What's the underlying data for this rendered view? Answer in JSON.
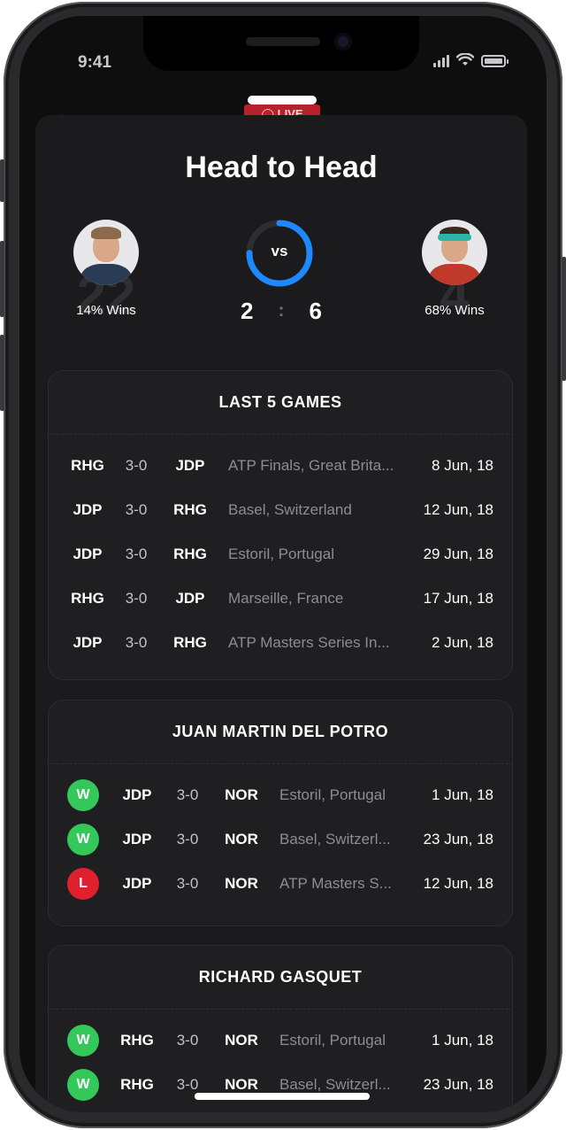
{
  "status": {
    "time": "9:41"
  },
  "background": {
    "back_glyph": "‹",
    "live_label": "◯ LIVE"
  },
  "sheet": {
    "title": "Head to Head"
  },
  "players": {
    "left": {
      "number": "22",
      "wins": "14% Wins",
      "shirt_color": "#2a3c55",
      "hair_color": "#8a6a4a"
    },
    "right": {
      "number": "4",
      "wins": "68% Wins",
      "shirt_color": "#c0392b",
      "hair_color": "#3b2a1f"
    }
  },
  "vs": {
    "label": "vs",
    "left_score": "2",
    "separator": ":",
    "right_score": "6",
    "ring_fraction": 0.75,
    "ring_color": "#1e88ff"
  },
  "last_games": {
    "title": "LAST 5 GAMES",
    "rows": [
      {
        "p1": "RHG",
        "score": "3-0",
        "p2": "JDP",
        "event": "ATP Finals, Great Brita...",
        "date": "8 Jun, 18"
      },
      {
        "p1": "JDP",
        "score": "3-0",
        "p2": "RHG",
        "event": "Basel, Switzerland",
        "date": "12 Jun, 18"
      },
      {
        "p1": "JDP",
        "score": "3-0",
        "p2": "RHG",
        "event": "Estoril, Portugal",
        "date": "29 Jun, 18"
      },
      {
        "p1": "RHG",
        "score": "3-0",
        "p2": "JDP",
        "event": "Marseille, France",
        "date": "17 Jun, 18"
      },
      {
        "p1": "JDP",
        "score": "3-0",
        "p2": "RHG",
        "event": "ATP Masters Series In...",
        "date": "2 Jun, 18"
      }
    ]
  },
  "potro": {
    "title": "JUAN MARTIN DEL POTRO",
    "rows": [
      {
        "result": "W",
        "p1": "JDP",
        "score": "3-0",
        "p2": "NOR",
        "event": "Estoril, Portugal",
        "date": "1 Jun, 18"
      },
      {
        "result": "W",
        "p1": "JDP",
        "score": "3-0",
        "p2": "NOR",
        "event": "Basel, Switzerl...",
        "date": "23 Jun, 18"
      },
      {
        "result": "L",
        "p1": "JDP",
        "score": "3-0",
        "p2": "NOR",
        "event": "ATP Masters S...",
        "date": "12 Jun, 18"
      }
    ]
  },
  "gasquet": {
    "title": "RICHARD GASQUET",
    "rows": [
      {
        "result": "W",
        "p1": "RHG",
        "score": "3-0",
        "p2": "NOR",
        "event": "Estoril, Portugal",
        "date": "1 Jun, 18"
      },
      {
        "result": "W",
        "p1": "RHG",
        "score": "3-0",
        "p2": "NOR",
        "event": "Basel, Switzerl...",
        "date": "23 Jun, 18"
      }
    ]
  },
  "colors": {
    "win": "#34c759",
    "loss": "#e0202e",
    "accent": "#1e88ff"
  }
}
